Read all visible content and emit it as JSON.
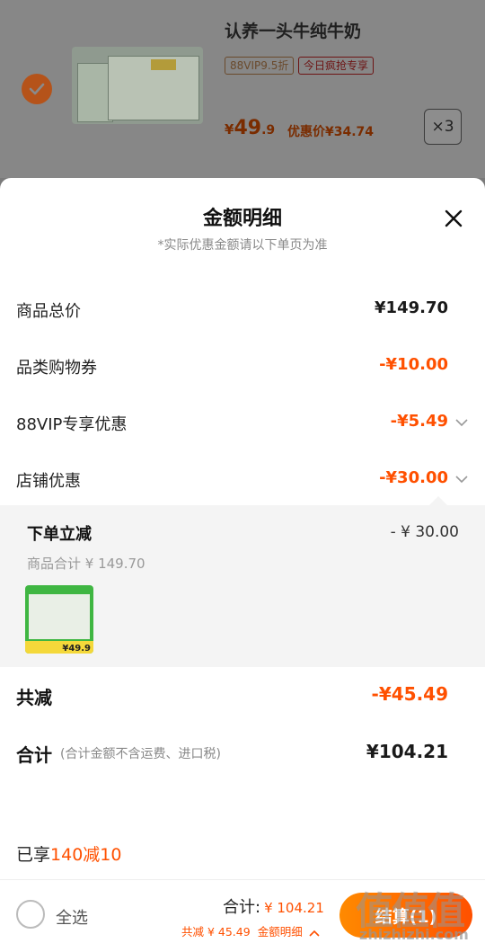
{
  "product": {
    "title": "认养一头牛纯牛奶",
    "tag_vip": "88VIP9.5折",
    "tag_today": "今日疯抢专享",
    "price_symbol": "¥",
    "price_int": "49",
    "price_dec": ".9",
    "discount_price": "优惠价¥34.74",
    "quantity": "×3"
  },
  "sheet": {
    "title": "金额明细",
    "subtitle": "*实际优惠金额请以下单页为准",
    "rows": [
      {
        "label": "商品总价",
        "value": "¥149.70"
      },
      {
        "label": "品类购物券",
        "value": "-¥10.00"
      },
      {
        "label": "88VIP专享优惠",
        "value": "-¥5.49"
      },
      {
        "label": "店铺优惠",
        "value": "-¥30.00"
      }
    ],
    "store_detail": {
      "title": "下单立减",
      "amount": "- ¥ 30.00",
      "goods_total": "商品合计 ¥ 149.70",
      "thumb_price": "¥49.9"
    },
    "total_reduction": {
      "label": "共减",
      "value": "-¥45.49"
    },
    "grand_total": {
      "label": "合计",
      "note": "(合计金额不含运费、进口税)",
      "value": "¥104.21"
    },
    "enjoy_prefix": "已享",
    "enjoy_highlight": "140减10"
  },
  "bottom_bar": {
    "select_all": "全选",
    "total_label": "合计:",
    "total_amount": "¥ 104.21",
    "saved": "共减 ¥ 45.49",
    "detail_link": "金额明细",
    "checkout_label": "结算(1)"
  },
  "watermark": {
    "glyphs": "值值值",
    "site": "zhizhizhi.com"
  },
  "colors": {
    "accent": "#ff5000",
    "overlay": "#878787"
  }
}
